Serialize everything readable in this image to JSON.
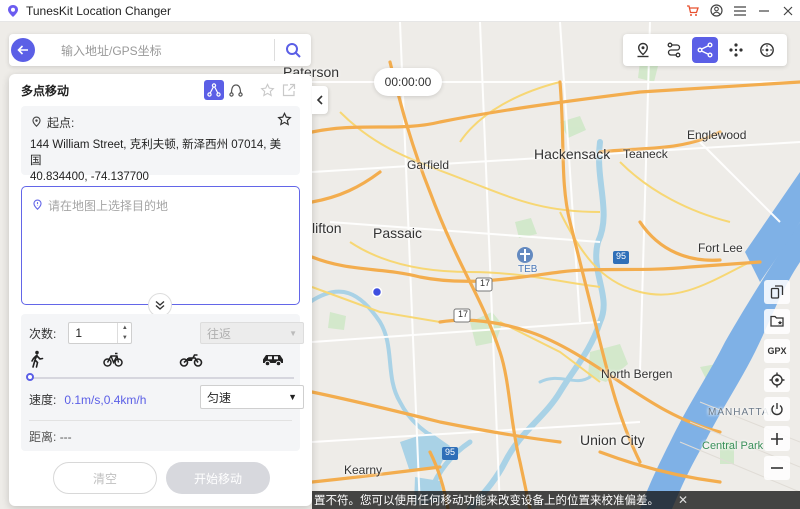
{
  "app": {
    "title": "TunesKit Location Changer"
  },
  "search": {
    "placeholder": "输入地址/GPS坐标"
  },
  "timer": "00:00:00",
  "panel": {
    "title": "多点移动",
    "start_label": "起点:",
    "start_address": "144 William Street, 克利夫顿, 新泽西州 07014, 美国",
    "start_coords": "40.834400, -74.137700",
    "dest_placeholder": "请在地图上选择目的地",
    "count_label": "次数:",
    "count_value": "1",
    "roundtrip_label": "往返",
    "speed_label": "速度:",
    "speed_value": "0.1m/s,0.4km/h",
    "speed_mode": "匀速",
    "speed_level": 0,
    "distance_label": "距离:",
    "distance_value": "---",
    "clear_label": "清空",
    "start_label_btn": "开始移动"
  },
  "side_tools": {
    "gpx_label": "GPX"
  },
  "notice": "置不符。您可以使用任何移动功能来改变设备上的位置来校准偏差。",
  "map": {
    "labels": {
      "paterson": "Paterson",
      "garfield": "Garfield",
      "hackensack": "Hackensack",
      "teaneck": "Teaneck",
      "englewood": "Englewood",
      "clifton": "lifton",
      "passaic": "Passaic",
      "teb": "TEB",
      "fort_lee": "Fort Lee",
      "north_bergen": "North Bergen",
      "union_city": "Union City",
      "kearny": "Kearny",
      "manhattan": "MANHATTAN",
      "central_park": "Central Park",
      "route_17a": "17",
      "route_17b": "17",
      "route_95a": "95",
      "route_95b": "95"
    }
  },
  "colors": {
    "accent": "#5b5fe6",
    "highway": "#f4b04f",
    "water": "#aad3df",
    "park": "#c8e6c0"
  }
}
